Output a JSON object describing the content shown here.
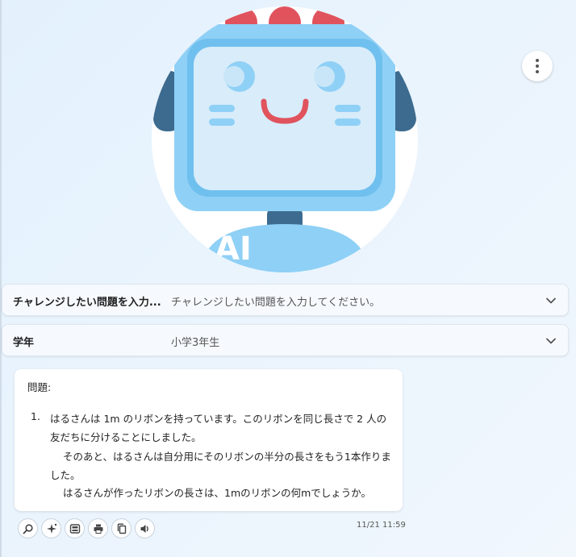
{
  "avatar": {
    "badge_text": "AI"
  },
  "header": {
    "menu_icon": "more-vert-icon"
  },
  "fields": [
    {
      "label": "チャレンジしたい問題を入力...",
      "value": "チャレンジしたい問題を入力してください。",
      "icon": "chevron-down-icon"
    },
    {
      "label": "学年",
      "value": "小学3年生",
      "icon": "chevron-down-icon"
    }
  ],
  "message": {
    "heading": "問題:",
    "item_number": "1.",
    "lines": [
      "はるさんは 1m のリボンを持っています。このリボンを同じ長さで 2 人の",
      "友だちに分けることにしました。",
      "そのあと、はるさんは自分用にそのリボンの半分の長さをもう1本作りま",
      "した。",
      "はるさんが作ったリボンの長さは、1mのリボンの何mでしょうか。"
    ],
    "timestamp": "11/21 11:59"
  },
  "actions": [
    {
      "name": "zoom-icon"
    },
    {
      "name": "sparkle-icon"
    },
    {
      "name": "image-layout-icon"
    },
    {
      "name": "print-icon"
    },
    {
      "name": "copy-icon"
    },
    {
      "name": "speaker-icon"
    }
  ],
  "colors": {
    "robot_blue": "#8fd0f6",
    "robot_dark": "#3d6b8f",
    "robot_red": "#e0535d",
    "screen": "#d8ecfa",
    "background": "#e8f3fd"
  }
}
